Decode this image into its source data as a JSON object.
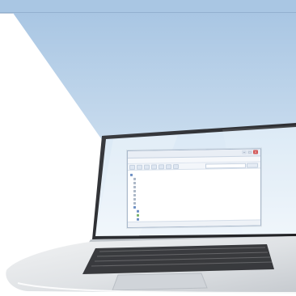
{
  "window": {
    "title": "",
    "buttons": {
      "minimize": "–",
      "maximize": "□",
      "close": "×"
    }
  },
  "menu": [],
  "toolbar": {
    "search_placeholder": ""
  },
  "tree": [
    {
      "label": ""
    },
    {
      "label": ""
    },
    {
      "label": ""
    },
    {
      "label": ""
    },
    {
      "label": ""
    },
    {
      "label": ""
    },
    {
      "label": ""
    },
    {
      "label": ""
    },
    {
      "label": ""
    },
    {
      "label": ""
    },
    {
      "label": ""
    },
    {
      "label": ""
    },
    {
      "label": ""
    }
  ],
  "status": {
    "text": ""
  },
  "colors": {
    "backdrop": "#ffffff",
    "projection_beam": "#bcd2e6",
    "screen_bezel": "#2d2f33",
    "laptop_body": "#e2e4e6",
    "window_accent": "#6c8fc4"
  }
}
